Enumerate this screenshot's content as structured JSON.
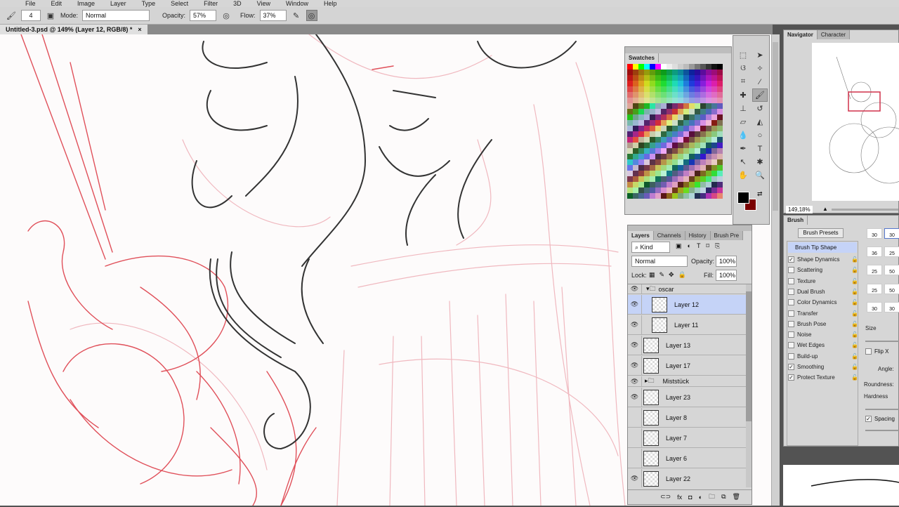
{
  "menu": [
    "File",
    "Edit",
    "Image",
    "Layer",
    "Type",
    "Select",
    "Filter",
    "3D",
    "View",
    "Window",
    "Help"
  ],
  "options": {
    "brush_size": "4",
    "mode_label": "Mode:",
    "mode_value": "Normal",
    "opacity_label": "Opacity:",
    "opacity_value": "57%",
    "flow_label": "Flow:",
    "flow_value": "37%"
  },
  "document": {
    "tab_title": "Untitled-3.psd @ 149% (Layer 12, RGB/8) *",
    "close": "×"
  },
  "swatches": {
    "title": "Swatches"
  },
  "layers": {
    "tabs": [
      "Layers",
      "Channels",
      "History",
      "Brush Pre"
    ],
    "filter_kind": "Kind",
    "blend_mode": "Normal",
    "opacity_label": "Opacity:",
    "opacity_value": "100%",
    "lock_label": "Lock:",
    "fill_label": "Fill:",
    "fill_value": "100%",
    "items": [
      {
        "name": "oscar",
        "type": "group",
        "visible": true,
        "expanded": true
      },
      {
        "name": "Layer 12",
        "type": "layer",
        "visible": true,
        "selected": true
      },
      {
        "name": "Layer 11",
        "type": "layer",
        "visible": true
      },
      {
        "name": "Layer 13",
        "type": "layer",
        "visible": true
      },
      {
        "name": "Layer 17",
        "type": "layer",
        "visible": true
      },
      {
        "name": "Miststück",
        "type": "group",
        "visible": true,
        "expanded": false
      },
      {
        "name": "Layer 23",
        "type": "layer",
        "visible": true
      },
      {
        "name": "Layer 8",
        "type": "layer",
        "visible": false
      },
      {
        "name": "Layer 7",
        "type": "layer",
        "visible": false
      },
      {
        "name": "Layer 6",
        "type": "layer",
        "visible": false
      },
      {
        "name": "Layer 22",
        "type": "layer",
        "visible": true
      }
    ]
  },
  "navigator": {
    "tabs": [
      "Navigator",
      "Character"
    ],
    "zoom": "149,18%"
  },
  "brush": {
    "tab": "Brush",
    "presets_button": "Brush Presets",
    "tip_shape": "Brush Tip Shape",
    "options": [
      {
        "label": "Shape Dynamics",
        "checked": true
      },
      {
        "label": "Scattering",
        "checked": false
      },
      {
        "label": "Texture",
        "checked": false
      },
      {
        "label": "Dual Brush",
        "checked": false
      },
      {
        "label": "Color Dynamics",
        "checked": false
      },
      {
        "label": "Transfer",
        "checked": false
      },
      {
        "label": "Brush Pose",
        "checked": false
      },
      {
        "label": "Noise",
        "checked": false
      },
      {
        "label": "Wet Edges",
        "checked": false
      },
      {
        "label": "Build-up",
        "checked": false
      },
      {
        "label": "Smoothing",
        "checked": true
      },
      {
        "label": "Protect Texture",
        "checked": true
      }
    ],
    "tip_sizes": [
      "30",
      "30",
      "36",
      "25",
      "25",
      "50",
      "25",
      "50",
      "30",
      "30"
    ],
    "size_label": "Size",
    "flip_x": "Flip X",
    "angle_label": "Angle:",
    "roundness_label": "Roundness:",
    "hardness_label": "Hardness",
    "spacing_label": "Spacing"
  },
  "colors": {
    "foreground": "#000000",
    "background": "#7a0000",
    "selection": "#c5d3f7",
    "sketch_red": "#e0505a",
    "sketch_pink": "#f0b8bf"
  }
}
